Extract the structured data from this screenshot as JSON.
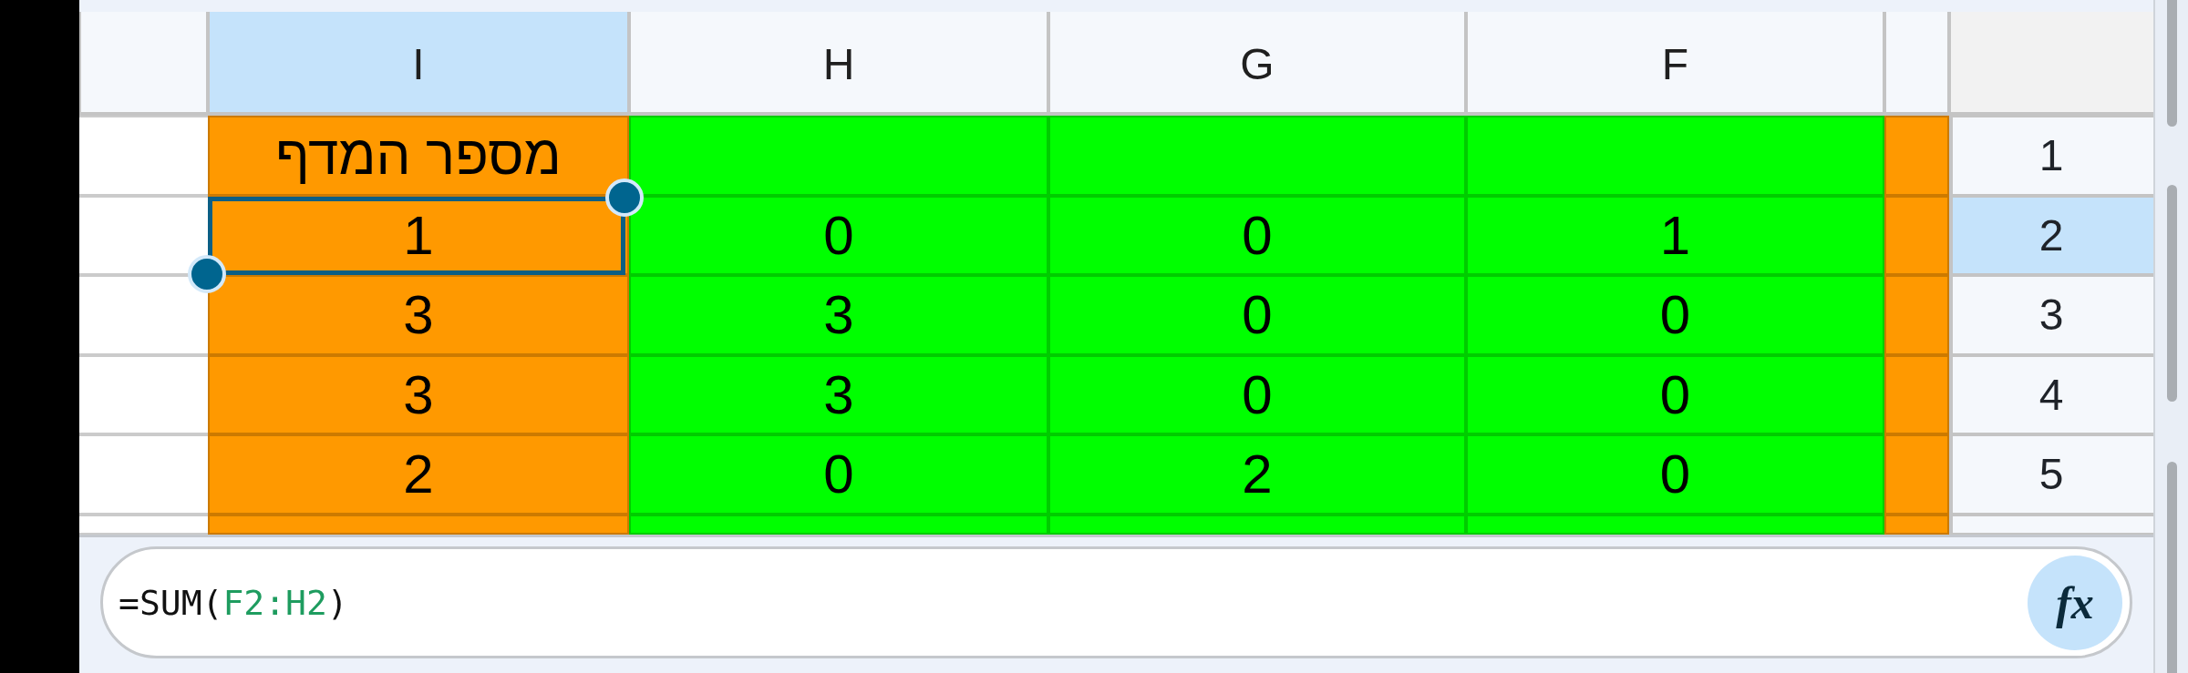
{
  "grid": {
    "columns": [
      {
        "selected": false,
        "color": "#ff9900"
      },
      {
        "label": "F",
        "selected": false,
        "color": "#00ff00"
      },
      {
        "label": "G",
        "selected": false,
        "color": "#00ff00"
      },
      {
        "label": "H",
        "selected": false,
        "color": "#00ff00"
      },
      {
        "label": "I",
        "selected": true,
        "color": "#ff9900"
      },
      {
        "selected": false
      }
    ],
    "rows": [
      {
        "kind": "full",
        "number": "1",
        "selected": false,
        "cells": [
          {
            "selected": false
          },
          {
            "selected": false
          },
          {
            "selected": false
          },
          {
            "selected": false
          },
          {
            "value": "מספר המדף",
            "selected": false
          },
          {
            "selected": false
          }
        ]
      },
      {
        "kind": "full",
        "number": "2",
        "selected": true,
        "cells": [
          {
            "selected": false
          },
          {
            "value": "1",
            "selected": false
          },
          {
            "value": "0",
            "selected": false
          },
          {
            "value": "0",
            "selected": false
          },
          {
            "value": "1",
            "selected": true
          },
          {
            "selected": false
          }
        ]
      },
      {
        "kind": "full",
        "number": "3",
        "selected": false,
        "cells": [
          {
            "selected": false
          },
          {
            "value": "0",
            "selected": false
          },
          {
            "value": "0",
            "selected": false
          },
          {
            "value": "3",
            "selected": false
          },
          {
            "value": "3",
            "selected": false
          },
          {
            "selected": false
          }
        ]
      },
      {
        "kind": "full",
        "number": "4",
        "selected": false,
        "cells": [
          {
            "selected": false
          },
          {
            "value": "0",
            "selected": false
          },
          {
            "value": "0",
            "selected": false
          },
          {
            "value": "3",
            "selected": false
          },
          {
            "value": "3",
            "selected": false
          },
          {
            "selected": false
          }
        ]
      },
      {
        "kind": "full",
        "number": "5",
        "selected": false,
        "cells": [
          {
            "selected": false
          },
          {
            "value": "0",
            "selected": false
          },
          {
            "value": "2",
            "selected": false
          },
          {
            "value": "0",
            "selected": false
          },
          {
            "value": "2",
            "selected": false
          },
          {
            "selected": false
          }
        ]
      },
      {
        "kind": "cut",
        "selected": false,
        "cells": [
          {
            "selected": false
          },
          {
            "selected": false
          },
          {
            "selected": false
          },
          {
            "selected": false
          },
          {
            "selected": false
          },
          {
            "selected": false
          }
        ]
      }
    ]
  },
  "formula_bar": {
    "formula": {
      "before": "=SUM(",
      "reference": "F2:H2",
      "after": ")"
    },
    "function_button": {
      "label": "fx"
    }
  }
}
